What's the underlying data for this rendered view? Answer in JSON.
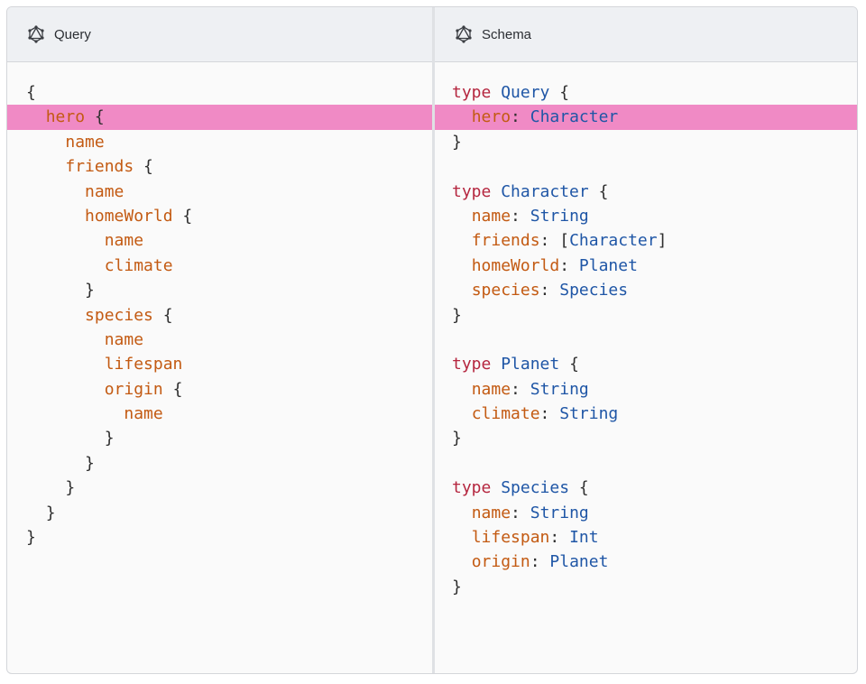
{
  "query_panel": {
    "title": "Query",
    "icon": "graphql-icon",
    "lines": [
      {
        "indent": "",
        "field": "",
        "punct": "{",
        "highlight": false
      },
      {
        "indent": "  ",
        "field": "hero",
        "punct": " {",
        "highlight": true
      },
      {
        "indent": "    ",
        "field": "name",
        "punct": "",
        "highlight": false
      },
      {
        "indent": "    ",
        "field": "friends",
        "punct": " {",
        "highlight": false
      },
      {
        "indent": "      ",
        "field": "name",
        "punct": "",
        "highlight": false
      },
      {
        "indent": "      ",
        "field": "homeWorld",
        "punct": " {",
        "highlight": false
      },
      {
        "indent": "        ",
        "field": "name",
        "punct": "",
        "highlight": false
      },
      {
        "indent": "        ",
        "field": "climate",
        "punct": "",
        "highlight": false
      },
      {
        "indent": "      ",
        "field": "",
        "punct": "}",
        "highlight": false
      },
      {
        "indent": "      ",
        "field": "species",
        "punct": " {",
        "highlight": false
      },
      {
        "indent": "        ",
        "field": "name",
        "punct": "",
        "highlight": false
      },
      {
        "indent": "        ",
        "field": "lifespan",
        "punct": "",
        "highlight": false
      },
      {
        "indent": "        ",
        "field": "origin",
        "punct": " {",
        "highlight": false
      },
      {
        "indent": "          ",
        "field": "name",
        "punct": "",
        "highlight": false
      },
      {
        "indent": "        ",
        "field": "",
        "punct": "}",
        "highlight": false
      },
      {
        "indent": "      ",
        "field": "",
        "punct": "}",
        "highlight": false
      },
      {
        "indent": "    ",
        "field": "",
        "punct": "}",
        "highlight": false
      },
      {
        "indent": "  ",
        "field": "",
        "punct": "}",
        "highlight": false
      },
      {
        "indent": "",
        "field": "",
        "punct": "}",
        "highlight": false
      }
    ]
  },
  "schema_panel": {
    "title": "Schema",
    "icon": "graphql-icon",
    "lines": [
      {
        "indent": "",
        "keyword": "type",
        "name": "Query",
        "field": "",
        "sep": "",
        "type_pre": "",
        "type": "",
        "type_post": "",
        "punct": " {",
        "highlight": false
      },
      {
        "indent": "  ",
        "keyword": "",
        "name": "",
        "field": "hero",
        "sep": ": ",
        "type_pre": "",
        "type": "Character",
        "type_post": "",
        "punct": "",
        "highlight": true
      },
      {
        "indent": "",
        "keyword": "",
        "name": "",
        "field": "",
        "sep": "",
        "type_pre": "",
        "type": "",
        "type_post": "",
        "punct": "}",
        "highlight": false
      },
      {
        "indent": "",
        "keyword": "",
        "name": "",
        "field": "",
        "sep": "",
        "type_pre": "",
        "type": "",
        "type_post": "",
        "punct": "",
        "highlight": false
      },
      {
        "indent": "",
        "keyword": "type",
        "name": "Character",
        "field": "",
        "sep": "",
        "type_pre": "",
        "type": "",
        "type_post": "",
        "punct": " {",
        "highlight": false
      },
      {
        "indent": "  ",
        "keyword": "",
        "name": "",
        "field": "name",
        "sep": ": ",
        "type_pre": "",
        "type": "String",
        "type_post": "",
        "punct": "",
        "highlight": false
      },
      {
        "indent": "  ",
        "keyword": "",
        "name": "",
        "field": "friends",
        "sep": ": ",
        "type_pre": "[",
        "type": "Character",
        "type_post": "]",
        "punct": "",
        "highlight": false
      },
      {
        "indent": "  ",
        "keyword": "",
        "name": "",
        "field": "homeWorld",
        "sep": ": ",
        "type_pre": "",
        "type": "Planet",
        "type_post": "",
        "punct": "",
        "highlight": false
      },
      {
        "indent": "  ",
        "keyword": "",
        "name": "",
        "field": "species",
        "sep": ": ",
        "type_pre": "",
        "type": "Species",
        "type_post": "",
        "punct": "",
        "highlight": false
      },
      {
        "indent": "",
        "keyword": "",
        "name": "",
        "field": "",
        "sep": "",
        "type_pre": "",
        "type": "",
        "type_post": "",
        "punct": "}",
        "highlight": false
      },
      {
        "indent": "",
        "keyword": "",
        "name": "",
        "field": "",
        "sep": "",
        "type_pre": "",
        "type": "",
        "type_post": "",
        "punct": "",
        "highlight": false
      },
      {
        "indent": "",
        "keyword": "type",
        "name": "Planet",
        "field": "",
        "sep": "",
        "type_pre": "",
        "type": "",
        "type_post": "",
        "punct": " {",
        "highlight": false
      },
      {
        "indent": "  ",
        "keyword": "",
        "name": "",
        "field": "name",
        "sep": ": ",
        "type_pre": "",
        "type": "String",
        "type_post": "",
        "punct": "",
        "highlight": false
      },
      {
        "indent": "  ",
        "keyword": "",
        "name": "",
        "field": "climate",
        "sep": ": ",
        "type_pre": "",
        "type": "String",
        "type_post": "",
        "punct": "",
        "highlight": false
      },
      {
        "indent": "",
        "keyword": "",
        "name": "",
        "field": "",
        "sep": "",
        "type_pre": "",
        "type": "",
        "type_post": "",
        "punct": "}",
        "highlight": false
      },
      {
        "indent": "",
        "keyword": "",
        "name": "",
        "field": "",
        "sep": "",
        "type_pre": "",
        "type": "",
        "type_post": "",
        "punct": "",
        "highlight": false
      },
      {
        "indent": "",
        "keyword": "type",
        "name": "Species",
        "field": "",
        "sep": "",
        "type_pre": "",
        "type": "",
        "type_post": "",
        "punct": " {",
        "highlight": false
      },
      {
        "indent": "  ",
        "keyword": "",
        "name": "",
        "field": "name",
        "sep": ": ",
        "type_pre": "",
        "type": "String",
        "type_post": "",
        "punct": "",
        "highlight": false
      },
      {
        "indent": "  ",
        "keyword": "",
        "name": "",
        "field": "lifespan",
        "sep": ": ",
        "type_pre": "",
        "type": "Int",
        "type_post": "",
        "punct": "",
        "highlight": false
      },
      {
        "indent": "  ",
        "keyword": "",
        "name": "",
        "field": "origin",
        "sep": ": ",
        "type_pre": "",
        "type": "Planet",
        "type_post": "",
        "punct": "",
        "highlight": false
      },
      {
        "indent": "",
        "keyword": "",
        "name": "",
        "field": "",
        "sep": "",
        "type_pre": "",
        "type": "",
        "type_post": "",
        "punct": "}",
        "highlight": false
      }
    ]
  },
  "colors": {
    "keyword": "#b5263f",
    "type_name": "#1f56a6",
    "field": "#c35a12",
    "punctuation": "#2e2e2e",
    "highlight": "#f08ac5",
    "header_bg": "#eef0f3"
  }
}
